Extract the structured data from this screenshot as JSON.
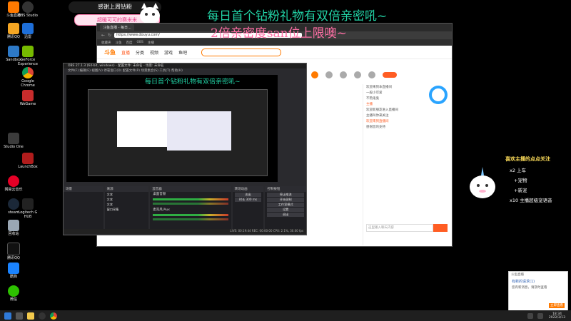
{
  "overlay": {
    "top_banner": "感谢上周钻粉",
    "pink_banner": "超暖可可的赛米米",
    "marquee_1": "每日首个钻粉礼物有双倍亲密吼~",
    "marquee_2": "2倍亲密度san位上限噢~",
    "obs_marquee": "每日首个钻粉礼物有双倍亲密吼~",
    "right_panel_title": "喜欢主播的点点关注",
    "right_items": [
      "x2 上车",
      "+宠物",
      "+新宠",
      "x10 主播超级宠语音"
    ],
    "corner_badge": "主播"
  },
  "desktop_icons": [
    {
      "label": "斗鱼直播"
    },
    {
      "label": "OBS Studio"
    },
    {
      "label": "腾讯QQ"
    },
    {
      "label": "迅雷"
    },
    {
      "label": "Sandbox"
    },
    {
      "label": "GeForce Experience"
    },
    {
      "label": "Google Chrome"
    },
    {
      "label": "WeGame"
    },
    {
      "label": "Studio One"
    },
    {
      "label": "LaunchBox"
    },
    {
      "label": "网易云音乐"
    },
    {
      "label": "steam"
    },
    {
      "label": "Logitech G HUB"
    },
    {
      "label": "回收站"
    },
    {
      "label": "腾讯QQ"
    },
    {
      "label": "酷狗"
    },
    {
      "label": "微信"
    }
  ],
  "browser": {
    "tabs": [
      "斗鱼直播 - 每日..."
    ],
    "url": "https://www.douyu.com/",
    "bookmarks": [
      "收藏夹",
      "斗鱼",
      "百度",
      "OBS",
      "主播"
    ],
    "nav": {
      "logo": "斗鱼",
      "items": [
        "直播",
        "分类",
        "视频",
        "游戏",
        "鱼吧"
      ]
    }
  },
  "chat": {
    "rows": [
      "欢迎来到本直播间",
      "一般小可爱",
      "不熟鬼鬼",
      "主播",
      "欢迎新朋友进入直播间",
      "主播叫你来关注",
      "欢迎来到直播间",
      "感谢您的支持"
    ],
    "input_placeholder": "这里输入聊天内容"
  },
  "obs": {
    "title": "OBS 27.1.3 (64-bit, windows) - 配置文件: 未命名 - 场景: 未命名",
    "menu": [
      "文件(F)",
      "编辑(E)",
      "视图(V)",
      "停靠窗口(D)",
      "配置文件(P)",
      "场景集合(S)",
      "工具(T)",
      "帮助(H)"
    ],
    "dock_headers": [
      "场景",
      "来源",
      "混音器",
      "转场动画",
      "控制按钮"
    ],
    "sources": [
      "文本",
      "文本",
      "文本",
      "窗口采集"
    ],
    "mixer": [
      "桌面音频",
      "麦克风/Aux"
    ],
    "transition": [
      "淡出",
      "时长 300 ms"
    ],
    "controls": [
      "停止推流",
      "开始录制",
      "工作室模式",
      "设置",
      "退出"
    ],
    "status": "LIVE: 00:19:44  REC: 00:00:00  CPU: 2.1%, 30.00 fps"
  },
  "taskbar": {
    "time": "18:34",
    "date": "2022/3/13"
  },
  "notification": {
    "title": "斗鱼直播",
    "heading": "有新的请求(1)",
    "body": "您有新消息，请及时查看",
    "button": "立即查看"
  }
}
